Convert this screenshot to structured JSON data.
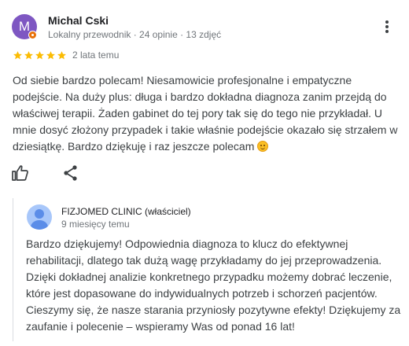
{
  "review": {
    "reviewer": {
      "initial": "M",
      "name": "Michal Cski",
      "meta": "Lokalny przewodnik · 24 opinie · 13 zdjęć"
    },
    "rating": {
      "stars": 5,
      "max": 5
    },
    "date": "2 lata temu",
    "text": "Od siebie bardzo polecam! Niesamowicie profesjonalne i empatyczne podejście. Na duży plus: długa i bardzo dokładna diagnoza zanim przejdą do właściwej terapii. Żaden gabinet do tej pory tak się do tego nie przykładał. U mnie dosyć złożony przypadek i takie właśnie podejście okazało się strzałem w dziesiątkę. Bardzo dziękuję i raz jeszcze polecam",
    "emoji": "grinning-face-emoji",
    "icons": {
      "like": "thumbs-up-icon",
      "share": "share-icon",
      "more": "more-vert-icon",
      "badge": "local-guide-badge-icon"
    },
    "colors": {
      "avatar_bg": "#7e57c2",
      "star": "#fbbc04",
      "badge": "#e8710a",
      "text": "#3c4043",
      "muted": "#70757a"
    }
  },
  "owner_reply": {
    "name": "FIZJOMED CLINIC (właściciel)",
    "date": "9 miesięcy temu",
    "text": "Bardzo dziękujemy! Odpowiednia diagnoza to klucz do efektywnej rehabilitacji, dlatego tak dużą wagę przykładamy do jej przeprowadzenia. Dzięki dokładnej analizie konkretnego przypadku możemy dobrać leczenie, które jest dopasowane do indywidualnych potrzeb i schorzeń pacjentów. Cieszymy się, że nasze starania przyniosły pozytywne efekty! Dziękujemy za zaufanie i polecenie – wspieramy Was od ponad 16 lat!",
    "colors": {
      "avatar_bg": "#a8c7fa",
      "avatar_fg": "#5b8de8",
      "border": "#dadce0"
    }
  }
}
